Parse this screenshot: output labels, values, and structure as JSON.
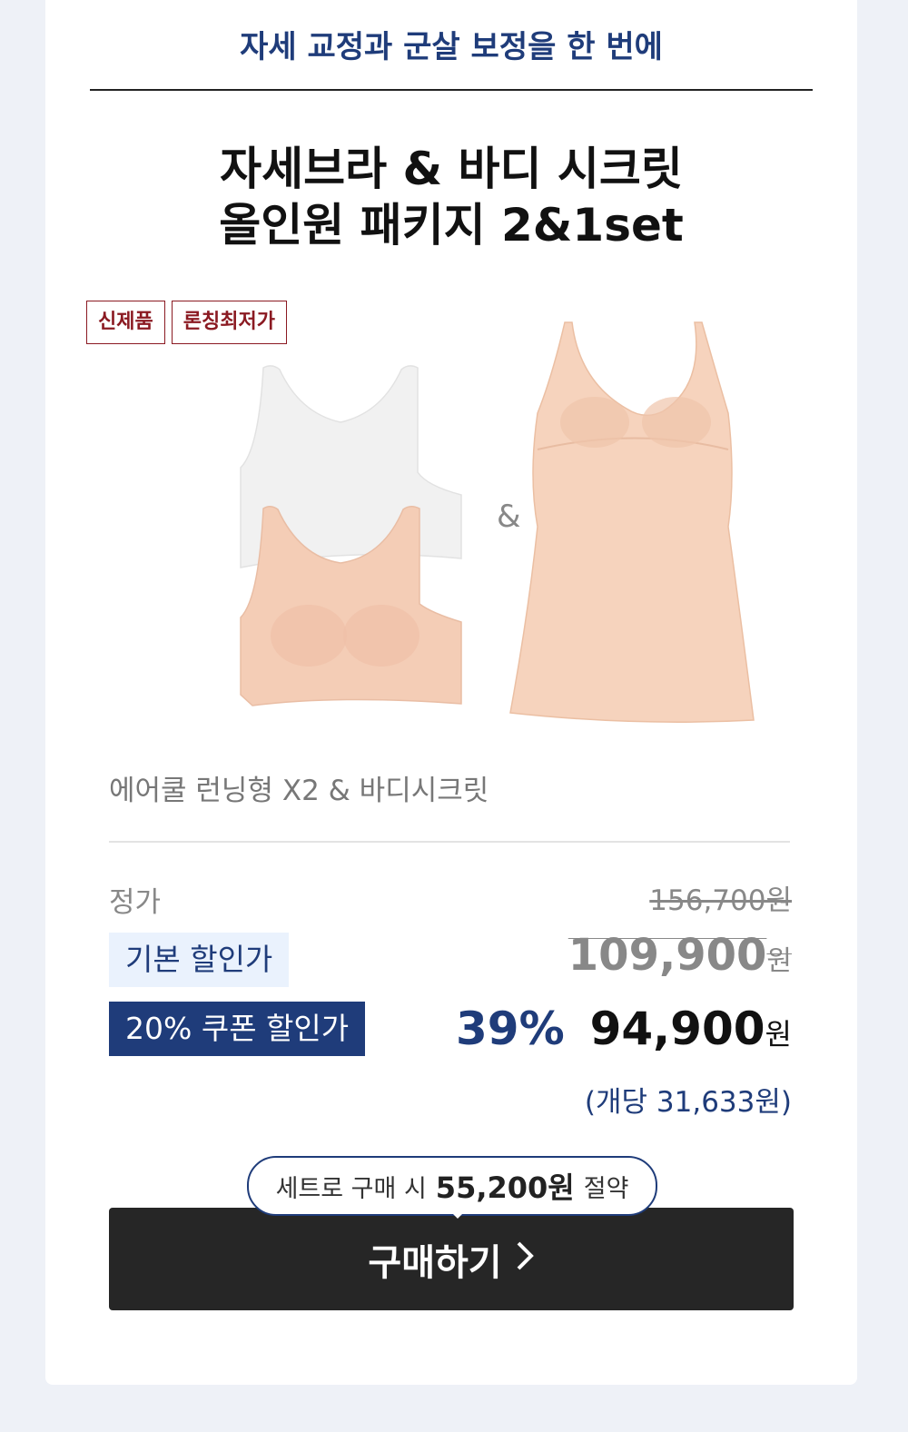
{
  "header": {
    "tagline": "자세 교정과 군살 보정을 한 번에"
  },
  "product": {
    "title_line1": "자세브라 & 바디 시크릿",
    "title_line2": "올인원 패키지 2&1set",
    "badges": [
      "신제품",
      "론칭최저가"
    ],
    "ampersand": "&",
    "name": "에어쿨 런닝형 X2 & 바디시크릿",
    "colors": {
      "white_bra": "#f2f2f2",
      "nude": "#f4cdb6",
      "accent": "#1f3c7a",
      "badge": "#8b1a22"
    }
  },
  "pricing": {
    "regular_label": "정가",
    "regular_price": "156,700원",
    "basic_label": "기본 할인가",
    "basic_price": "109,900",
    "coupon_label": "20% 쿠폰 할인가",
    "discount_rate": "39%",
    "final_price": "94,900",
    "currency": "원",
    "per_unit": "(개당 31,633원)"
  },
  "cta": {
    "savings_prefix": "세트로 구매 시",
    "savings_amount": "55,200원",
    "savings_suffix": "절약",
    "buy_label": "구매하기",
    "buy_icon": "chevron-right-icon"
  }
}
